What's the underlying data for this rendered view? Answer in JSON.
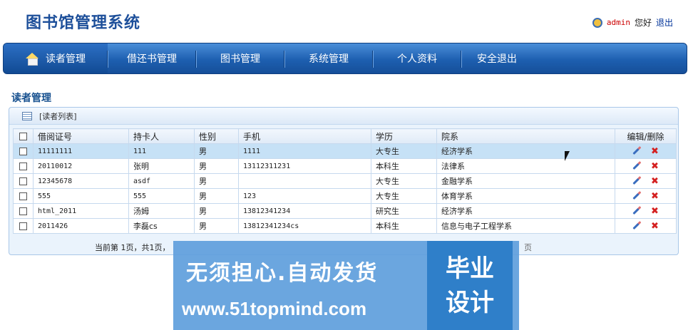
{
  "header": {
    "app_title": "图书馆管理系统",
    "user_name": "admin",
    "greeting": "您好",
    "logout": "退出"
  },
  "nav": {
    "items": [
      {
        "label": "读者管理",
        "active": true
      },
      {
        "label": "借还书管理"
      },
      {
        "label": "图书管理"
      },
      {
        "label": "系统管理"
      },
      {
        "label": "个人资料"
      },
      {
        "label": "安全退出"
      }
    ]
  },
  "section": {
    "title": "读者管理",
    "panel_label": "[读者列表]"
  },
  "table": {
    "columns": [
      "借阅证号",
      "持卡人",
      "性别",
      "手机",
      "学历",
      "院系",
      "编辑/删除"
    ],
    "rows": [
      {
        "card_no": "11111111",
        "holder": "111",
        "gender": "男",
        "phone": "1111",
        "education": "大专生",
        "department": "经济学系"
      },
      {
        "card_no": "20110012",
        "holder": "张明",
        "gender": "男",
        "phone": "13112311231",
        "education": "本科生",
        "department": "法律系"
      },
      {
        "card_no": "12345678",
        "holder": "asdf",
        "gender": "男",
        "phone": "",
        "education": "大专生",
        "department": "金融学系"
      },
      {
        "card_no": "555",
        "holder": "555",
        "gender": "男",
        "phone": "123",
        "education": "大专生",
        "department": "体育学系"
      },
      {
        "card_no": "html_2011",
        "holder": "汤姆",
        "gender": "男",
        "phone": "13812341234",
        "education": "研究生",
        "department": "经济学系"
      },
      {
        "card_no": "2011426",
        "holder": "李磊cs",
        "gender": "男",
        "phone": "13812341234cs",
        "education": "本科生",
        "department": "信息与电子工程学系"
      }
    ]
  },
  "pager": {
    "text": "当前第 1页，共1页，",
    "tail": "页"
  },
  "watermark": {
    "line1": "无须担心.自动发货",
    "line2": "www.51topmind.com",
    "badge_line1": "毕业",
    "badge_line2": "设计"
  },
  "colors": {
    "nav": "#1d5fb0",
    "title": "#1d4f9a",
    "selected_row": "#c6e1f6",
    "delete": "#d42020"
  }
}
